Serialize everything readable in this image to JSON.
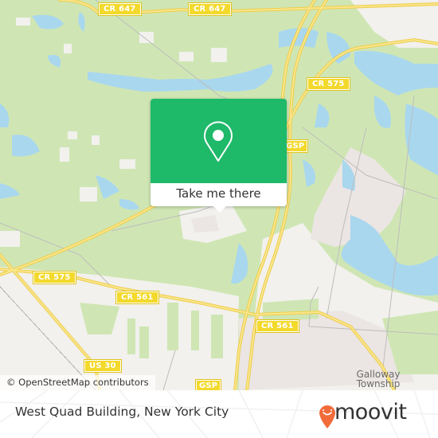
{
  "map": {
    "road_labels": [
      {
        "id": "cr647-a",
        "text": "CR 647"
      },
      {
        "id": "cr647-b",
        "text": "CR 647"
      },
      {
        "id": "cr575-ne",
        "text": "CR 575"
      },
      {
        "id": "gsp-n",
        "text": "GSP"
      },
      {
        "id": "cr575-w",
        "text": "CR 575"
      },
      {
        "id": "cr561-w",
        "text": "CR 561"
      },
      {
        "id": "cr561-e",
        "text": "CR 561"
      },
      {
        "id": "us30",
        "text": "US 30"
      },
      {
        "id": "gsp-s",
        "text": "GSP"
      }
    ],
    "place_labels": [
      {
        "id": "galloway",
        "line1": "Galloway",
        "line2": "Township"
      }
    ],
    "attribution": "© OpenStreetMap contributors",
    "colors": {
      "forest": "#cfe6b4",
      "water": "#a9d7ee",
      "urban": "#f2f1ed",
      "industrial": "#ebe5e3",
      "road": "#f6dc6a",
      "shield": "#f3d92b"
    }
  },
  "popup": {
    "icon": "map-pin-icon",
    "button_label": "Take me there",
    "color": "#1fb96a"
  },
  "footer": {
    "title": "West Quad Building, New York City",
    "brand": "moovit",
    "brand_color": "#f26b3a"
  }
}
